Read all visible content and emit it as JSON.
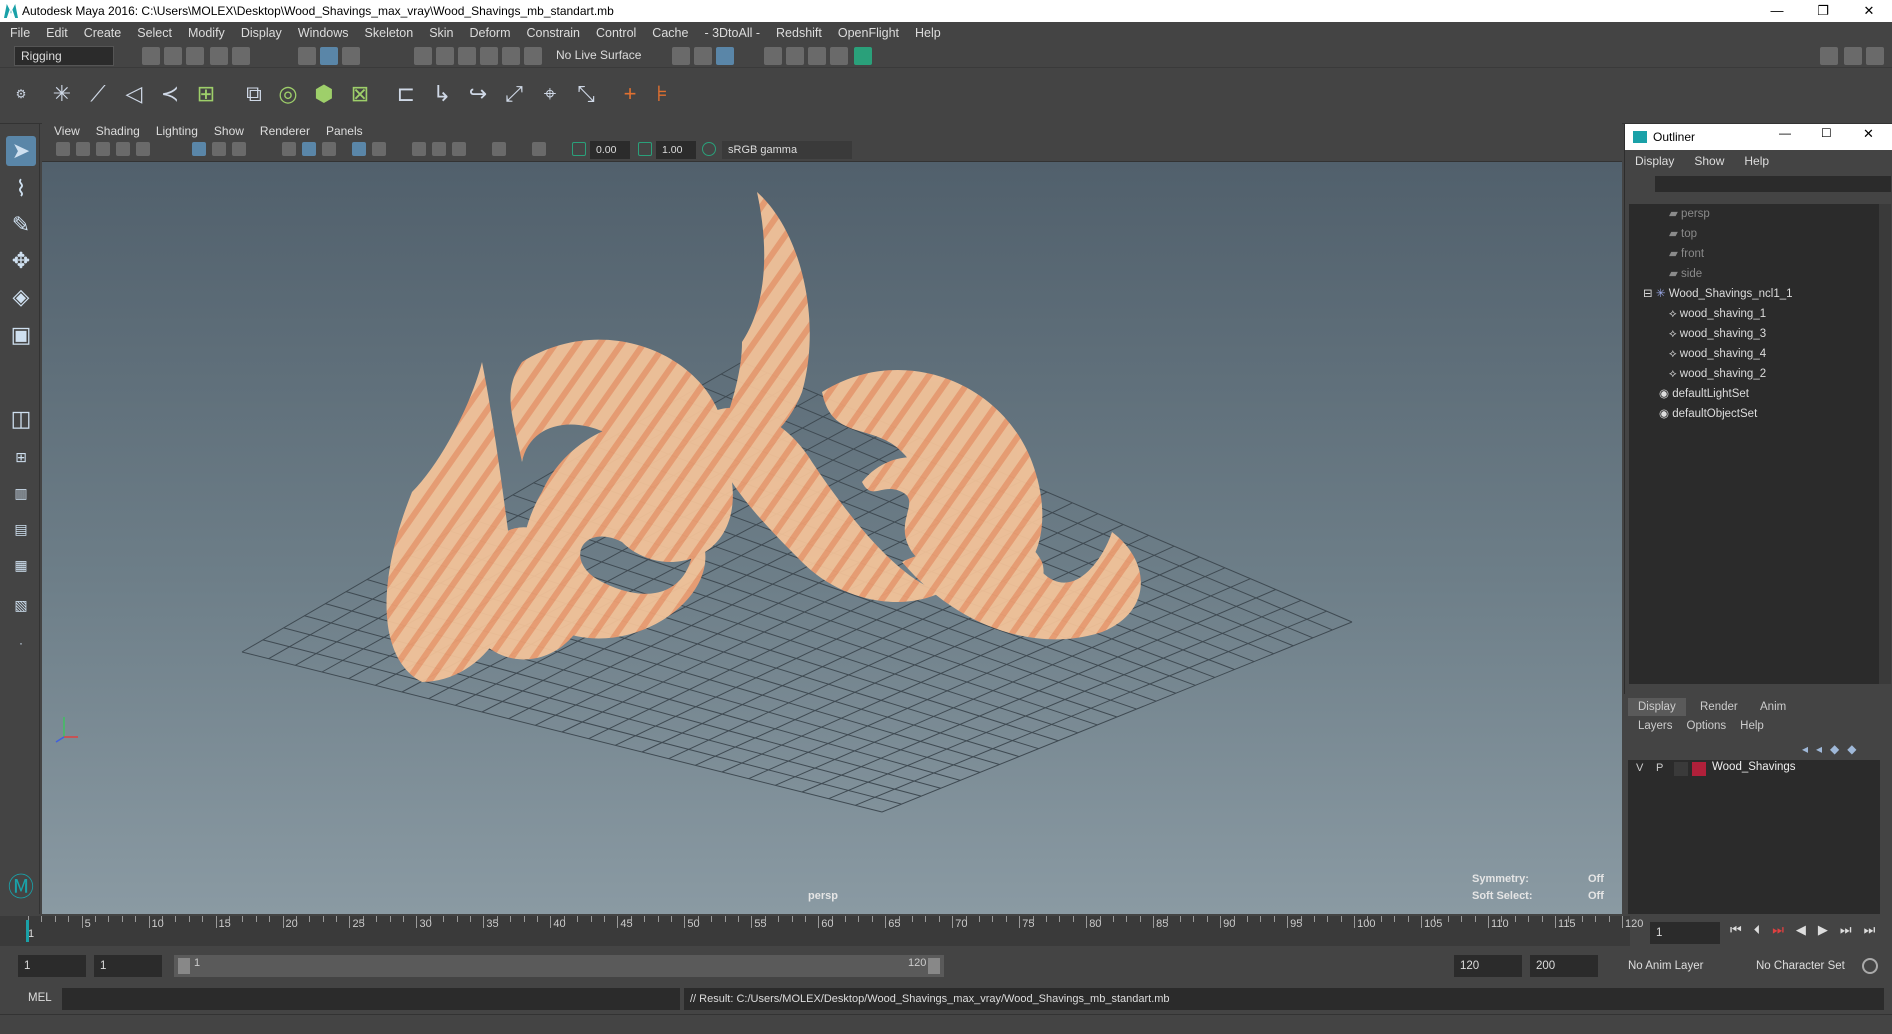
{
  "window": {
    "title": "Autodesk Maya 2016: C:\\Users\\MOLEX\\Desktop\\Wood_Shavings_max_vray\\Wood_Shavings_mb_standart.mb",
    "minimize": "—",
    "restore": "❐",
    "close": "✕"
  },
  "menubar": [
    "File",
    "Edit",
    "Create",
    "Select",
    "Modify",
    "Display",
    "Windows",
    "Skeleton",
    "Skin",
    "Deform",
    "Constrain",
    "Control",
    "Cache",
    "- 3DtoAll -",
    "Redshift",
    "OpenFlight",
    "Help"
  ],
  "statusline": {
    "menuset": "Rigging",
    "live_surface": "No Live Surface"
  },
  "viewport": {
    "menus": [
      "View",
      "Shading",
      "Lighting",
      "Show",
      "Renderer",
      "Panels"
    ],
    "exposure": "0.00",
    "gamma": "1.00",
    "colorspace": "sRGB gamma",
    "camera_label": "persp",
    "hud": {
      "symmetry_label": "Symmetry:",
      "symmetry_value": "Off",
      "softsel_label": "Soft Select:",
      "softsel_value": "Off"
    }
  },
  "outliner": {
    "title": "Outliner",
    "menus": [
      "Display",
      "Show",
      "Help"
    ],
    "items": [
      {
        "label": "persp",
        "dim": true
      },
      {
        "label": "top",
        "dim": true
      },
      {
        "label": "front",
        "dim": true
      },
      {
        "label": "side",
        "dim": true
      },
      {
        "label": "Wood_Shavings_ncl1_1"
      },
      {
        "label": "wood_shaving_1"
      },
      {
        "label": "wood_shaving_3"
      },
      {
        "label": "wood_shaving_4"
      },
      {
        "label": "wood_shaving_2"
      },
      {
        "label": "defaultLightSet"
      },
      {
        "label": "defaultObjectSet"
      }
    ]
  },
  "layer_editor": {
    "tabs": [
      "Display",
      "Render",
      "Anim"
    ],
    "menus": [
      "Layers",
      "Options",
      "Help"
    ],
    "layer": {
      "v": "V",
      "p": "P",
      "name": "Wood_Shavings",
      "color": "#b0203a"
    }
  },
  "timeline": {
    "ticks": [
      "5",
      "10",
      "15",
      "20",
      "25",
      "30",
      "35",
      "40",
      "45",
      "50",
      "55",
      "60",
      "65",
      "70",
      "75",
      "80",
      "85",
      "90",
      "95",
      "100",
      "105",
      "110",
      "115",
      "120"
    ],
    "start_tick": "1",
    "current_frame": "1"
  },
  "range": {
    "start": "1",
    "playback_start": "1",
    "slider_start": "1",
    "slider_end": "120",
    "playback_end": "120",
    "end": "200",
    "anim_layer": "No Anim Layer",
    "char_set": "No Character Set"
  },
  "commandline": {
    "lang": "MEL",
    "result": "// Result: C:/Users/MOLEX/Desktop/Wood_Shavings_max_vray/Wood_Shavings_mb_standart.mb"
  },
  "colors": {
    "accent": "#5a86a8",
    "wood": "#f0b080"
  }
}
